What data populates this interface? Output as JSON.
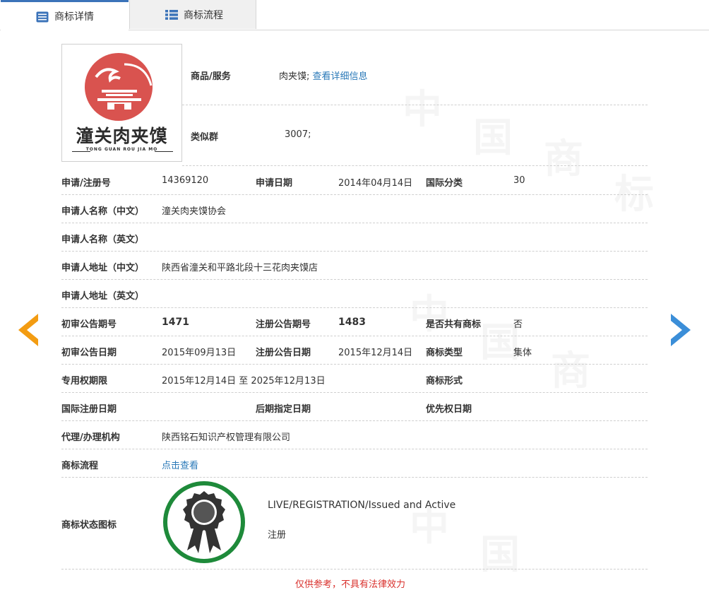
{
  "tabs": [
    {
      "label": "商标详情",
      "icon": "document-list-icon",
      "active": true
    },
    {
      "label": "商标流程",
      "icon": "flow-list-icon",
      "active": false
    }
  ],
  "logo": {
    "text": "潼关肉夹馍",
    "sub": "TONG GUAN ROU JIA MO",
    "colors": {
      "red": "#d9534f",
      "dark": "#2c2c2c"
    }
  },
  "goods": {
    "label": "商品/服务",
    "value": "肉夹馍;",
    "link": "查看详细信息"
  },
  "similar_group": {
    "label": "类似群",
    "value": "3007;"
  },
  "rows": {
    "reg_no": {
      "label": "申请/注册号",
      "value": "14369120"
    },
    "apply_date": {
      "label": "申请日期",
      "value": "2014年04月14日"
    },
    "intl_class": {
      "label": "国际分类",
      "value": "30"
    },
    "applicant_cn": {
      "label": "申请人名称（中文）",
      "value": "潼关肉夹馍协会"
    },
    "applicant_en": {
      "label": "申请人名称（英文）",
      "value": ""
    },
    "address_cn": {
      "label": "申请人地址（中文）",
      "value": "陕西省潼关和平路北段十三花肉夹馍店"
    },
    "address_en": {
      "label": "申请人地址（英文）",
      "value": ""
    },
    "prelim_no": {
      "label": "初审公告期号",
      "value": "1471"
    },
    "reg_pub_no": {
      "label": "注册公告期号",
      "value": "1483"
    },
    "shared": {
      "label": "是否共有商标",
      "value": "否"
    },
    "prelim_date": {
      "label": "初审公告日期",
      "value": "2015年09月13日"
    },
    "reg_pub_date": {
      "label": "注册公告日期",
      "value": "2015年12月14日"
    },
    "mark_type": {
      "label": "商标类型",
      "value": "集体"
    },
    "term": {
      "label": "专用权期限",
      "value": "2015年12月14日 至 2025年12月13日"
    },
    "mark_form": {
      "label": "商标形式",
      "value": ""
    },
    "intl_reg_date": {
      "label": "国际注册日期",
      "value": ""
    },
    "later_date": {
      "label": "后期指定日期",
      "value": ""
    },
    "priority_date": {
      "label": "优先权日期",
      "value": ""
    },
    "agent": {
      "label": "代理/办理机构",
      "value": "陕西铭石知识产权管理有限公司"
    },
    "process": {
      "label": "商标流程",
      "value": "点击查看"
    }
  },
  "status": {
    "label": "商标状态图标",
    "en": "LIVE/REGISTRATION/Issued and Active",
    "cn": "注册",
    "colors": {
      "ring": "#1e8a3a",
      "badge": "#333333"
    }
  },
  "footer": "仅供参考，不具有法律效力",
  "nav": {
    "prev_color": "#f39c12",
    "next_color": "#3b8ed8"
  },
  "watermark": [
    "中",
    "国",
    "商",
    "标"
  ]
}
